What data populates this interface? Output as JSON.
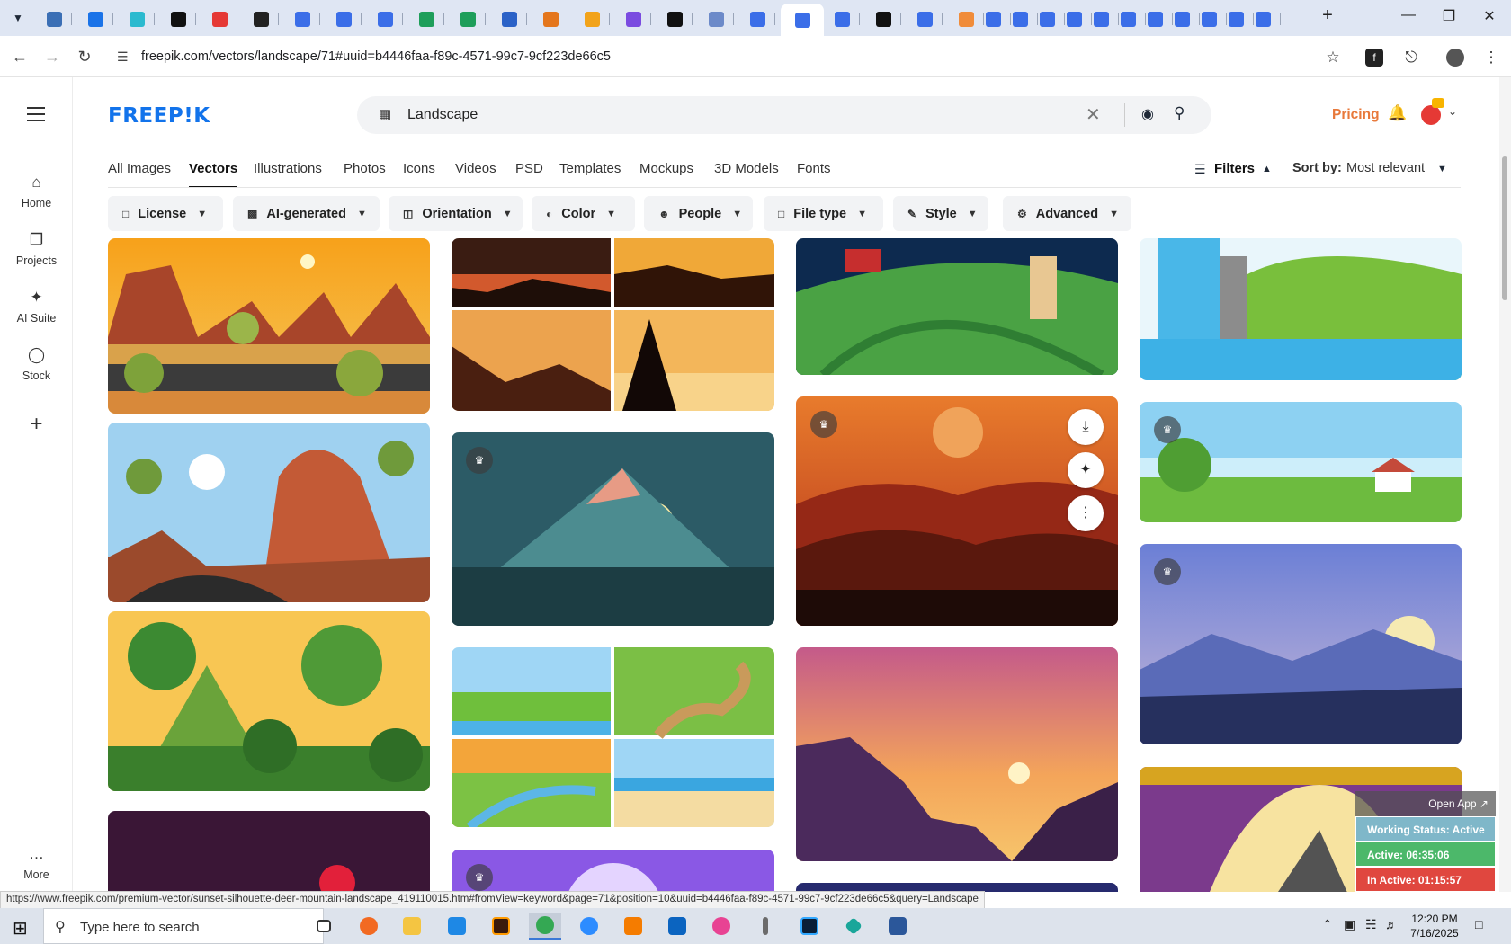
{
  "browser": {
    "url": "freepik.com/vectors/landscape/71#uuid=b4446faa-f89c-4571-99c7-9cf223de66c5",
    "status_url": "https://www.freepik.com/premium-vector/sunset-silhouette-deer-mountain-landscape_419110015.htm#fromView=keyword&page=71&position=10&uuid=b4446faa-f89c-4571-99c7-9cf223de66c5&query=Landscape",
    "tab_colors": [
      "#3b6fb5",
      "#1a73e8",
      "#2bbacf",
      "#111111",
      "#e53935",
      "#222222",
      "#3b6ee8",
      "#3b6ee8",
      "#3b6ee8",
      "#1e9e5a",
      "#1e9e5a",
      "#2b62c7",
      "#e4761c",
      "#f2a31a",
      "#7a4be0",
      "#111111",
      "#6c8ac9",
      "#3b6ee8",
      "#3b6ee8",
      "#3b6ee8",
      "#111111",
      "#3b6ee8",
      "#f08c3a",
      "#3b6ee8",
      "#3b6ee8",
      "#3b6ee8",
      "#3b6ee8",
      "#3b6ee8",
      "#3b6ee8",
      "#3b6ee8",
      "#3b6ee8",
      "#3b6ee8",
      "#3b6ee8",
      "#3b6ee8"
    ],
    "new_tab_label": "+"
  },
  "app": {
    "logo": "FREEP!K",
    "rail": [
      {
        "icon": "home-icon",
        "label": "Home"
      },
      {
        "icon": "projects-icon",
        "label": "Projects"
      },
      {
        "icon": "sparkle-icon",
        "label": "AI Suite"
      },
      {
        "icon": "stock-icon",
        "label": "Stock"
      }
    ],
    "more_label": "More",
    "search": {
      "value": "Landscape"
    },
    "pricing": "Pricing",
    "tabs": [
      "All Images",
      "Vectors",
      "Illustrations",
      "Photos",
      "Icons",
      "Videos",
      "PSD",
      "Templates",
      "Mockups",
      "3D Models",
      "Fonts"
    ],
    "active_tab": "Vectors",
    "filters_label": "Filters",
    "sort_label": "Sort by:",
    "sort_value": "Most relevant",
    "chips": [
      "License",
      "AI-generated",
      "Orientation",
      "Color",
      "People",
      "File type",
      "Style",
      "Advanced"
    ],
    "brand_color": "#1273eb",
    "pricing_color": "#e8793b"
  },
  "work_status": {
    "open_app": "Open App ↗",
    "status": "Working Status: Active",
    "active": "Active: 06:35:06",
    "inactive": "In Active: 01:15:57"
  },
  "taskbar": {
    "search_placeholder": "Type here to search",
    "time": "12:20 PM",
    "date": "7/16/2025"
  }
}
